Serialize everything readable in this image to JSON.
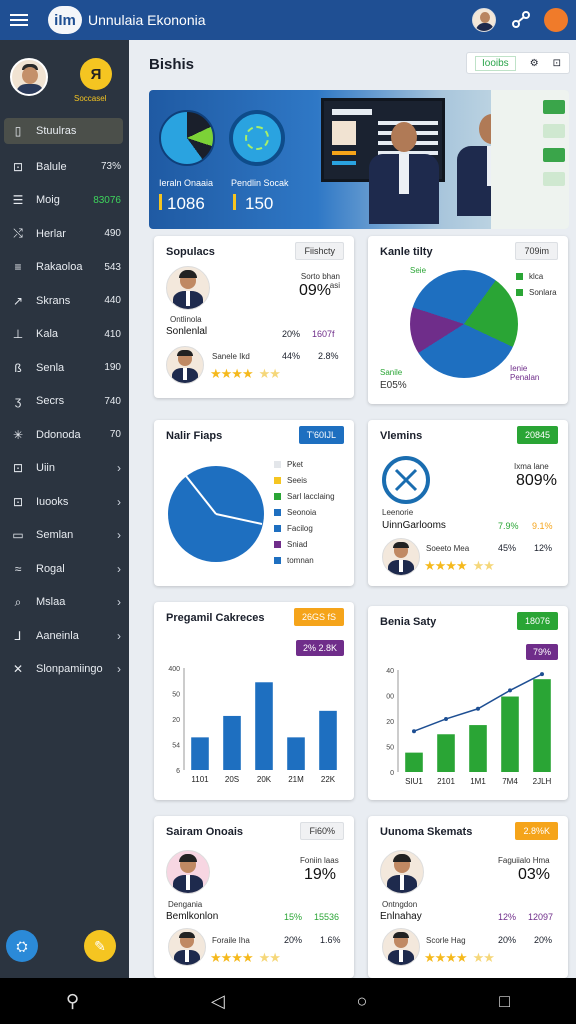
{
  "app": {
    "logo": "iIm",
    "title": "Unnulaia Ekononia"
  },
  "sidebar": {
    "badge": "Я",
    "badge_caption": "Soccasel",
    "items": [
      {
        "icon": "▯",
        "label": "Stuulras",
        "value": "",
        "active": true
      },
      {
        "icon": "⊡",
        "label": "Balule",
        "value": "73%"
      },
      {
        "icon": "☰",
        "label": "Moig",
        "value": "83076",
        "green": true
      },
      {
        "icon": "⤭",
        "label": "Herlar",
        "value": "490"
      },
      {
        "icon": "≡",
        "label": "Rakaoloa",
        "value": "543"
      },
      {
        "icon": "↗",
        "label": "Skrans",
        "value": "440"
      },
      {
        "icon": "⊥",
        "label": "Kala",
        "value": "410"
      },
      {
        "icon": "ß",
        "label": "Senla",
        "value": "190"
      },
      {
        "icon": "ʒ",
        "label": "Secrs",
        "value": "740"
      },
      {
        "icon": "✳",
        "label": "Ddonoda",
        "value": "70"
      },
      {
        "icon": "⊡",
        "label": "Uiin",
        "chev": "›"
      },
      {
        "icon": "⊡",
        "label": "Iuooks",
        "chev": "›"
      },
      {
        "icon": "▭",
        "label": "Semlan",
        "chev": "›"
      },
      {
        "icon": "≈",
        "label": "Rogal",
        "chev": "›"
      },
      {
        "icon": "⌕",
        "label": "Mslaa",
        "chev": "›"
      },
      {
        "icon": "⅃",
        "label": "Aaneinla",
        "chev": "›"
      },
      {
        "icon": "✕",
        "label": "Slonpamiingo",
        "chev": "›"
      }
    ]
  },
  "main": {
    "title": "Bishis",
    "tool_label": "Iooibs",
    "hero": {
      "label1": "Ieraln Onaaia",
      "value1": "1086",
      "label2": "Pendlin Socak",
      "value2": "150"
    }
  },
  "cards": {
    "c1": {
      "title": "Sopulacs",
      "btn": "Fiishcty",
      "kpi_label": "Sorto bhan\nasi",
      "kpi": "09%",
      "person_caption": "Ontlinola",
      "person_name": "Sonlenlal",
      "p1": "20%",
      "p2": "1607f",
      "row_label": "Sanele Ikd",
      "r1": "44%",
      "r2": "2.8%"
    },
    "c2": {
      "title": "Kanle tilty",
      "btn": "709im",
      "legend": [
        "klca",
        "Sonlara"
      ],
      "top_label": "Seie",
      "bottom_label1": "Sanile",
      "bottom_label2": "E05%",
      "right_label": "Ienie\nPenalan"
    },
    "c3": {
      "title": "Nalir Fiaps",
      "btn": "T'60IJL",
      "legend": [
        "Pket",
        "Seeis",
        "Sarl lacclaing",
        "Seonoia",
        "Facilog",
        "Sniad",
        "tomnan"
      ]
    },
    "c4": {
      "title": "Vlemins",
      "btn": "20845",
      "kpi_label": "Ixma lane",
      "kpi": "809%",
      "caption": "Leenorie",
      "name": "UinnGarlooms",
      "p1": "7.9%",
      "p2": "9.1%",
      "row_label": "Soeeto Mea",
      "r1": "45%",
      "r2": "12%"
    },
    "c5": {
      "title": "Pregamil Cakreces",
      "btn": "26GS fS",
      "tag": "2% 2.8K"
    },
    "c6": {
      "title": "Benia Saty",
      "btn": "18076",
      "tag": "79%"
    },
    "c7": {
      "title": "Sairam Onoais",
      "btn": "Fi60%",
      "kpi_label": "Foniin laas",
      "kpi": "19%",
      "caption": "Dengania",
      "name": "Bemlkonlon",
      "p1": "15%",
      "p2": "15536",
      "row_label": "Foraile Iha",
      "r1": "20%",
      "r2": "1.6%"
    },
    "c8": {
      "title": "Uunoma Skemats",
      "btn": "2.8%K",
      "kpi_label": "Faguiialo Hma",
      "kpi": "03%",
      "caption": "Ontngdon",
      "name": "Enlnahay",
      "p1": "12%",
      "p2": "12097",
      "row_label": "Scorle Hag",
      "r1": "20%",
      "r2": "20%"
    }
  },
  "chart_data": [
    {
      "type": "bar",
      "title": "Pregamil Cakreces",
      "categories": [
        "1101",
        "20S",
        "20K",
        "21M",
        "22K"
      ],
      "values": [
        32,
        53,
        86,
        32,
        58
      ],
      "ylim": [
        0,
        100
      ],
      "yticks": [
        "400",
        "50",
        "20",
        "54",
        "6"
      ],
      "color": "#1e6fc0"
    },
    {
      "type": "bar",
      "title": "Benia Saty",
      "categories": [
        "SIU1",
        "2101",
        "1M1",
        "7M4",
        "2JLH"
      ],
      "values": [
        19,
        37,
        46,
        74,
        91
      ],
      "line": [
        40,
        52,
        62,
        80,
        96
      ],
      "ylim": [
        0,
        100
      ],
      "yticks": [
        "40",
        "00",
        "20",
        "50",
        "0"
      ],
      "color": "#2aa535"
    }
  ]
}
